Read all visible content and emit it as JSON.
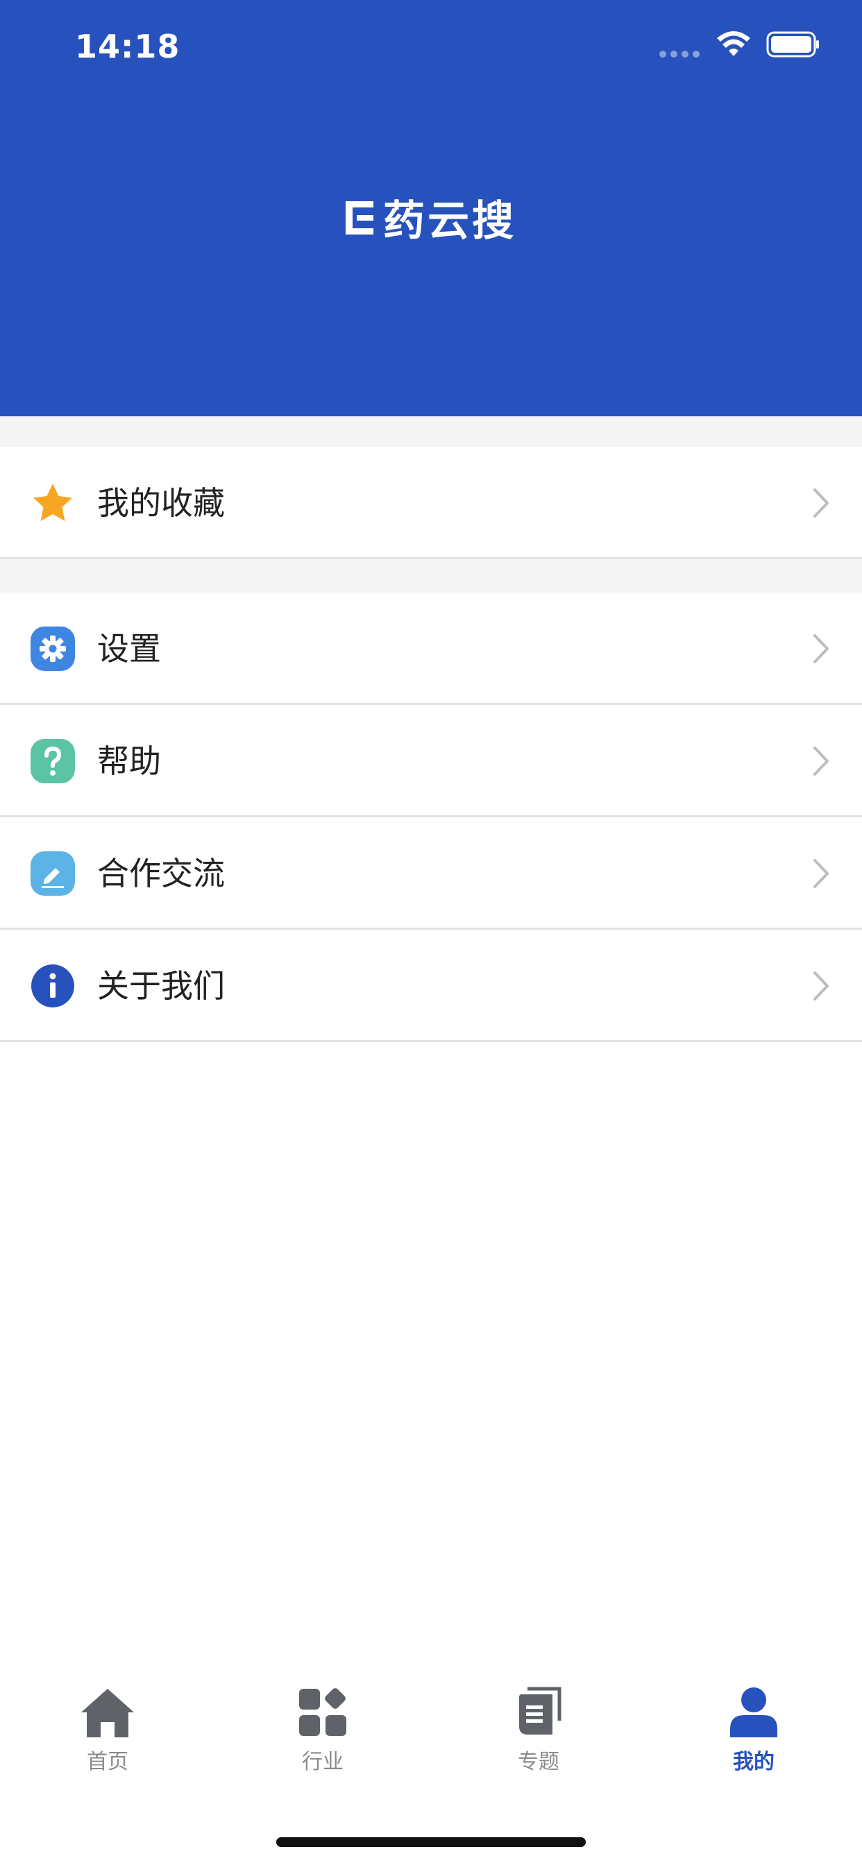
{
  "status_bar": {
    "time": "14:18"
  },
  "header": {
    "logo_text": "药云搜"
  },
  "menu": {
    "favorites": {
      "label": "我的收藏",
      "icon": "star-icon",
      "icon_color": "#F6A623"
    },
    "settings": {
      "label": "设置",
      "icon": "gear-icon",
      "icon_color": "#3F86E2"
    },
    "help": {
      "label": "帮助",
      "icon": "question-icon",
      "icon_color": "#5AC4A5"
    },
    "cooperation": {
      "label": "合作交流",
      "icon": "pencil-icon",
      "icon_color": "#5BB3E6"
    },
    "about": {
      "label": "关于我们",
      "icon": "info-icon",
      "icon_color": "#2752BD"
    }
  },
  "tabbar": {
    "items": [
      {
        "label": "首页",
        "icon": "home-icon",
        "active": false
      },
      {
        "label": "行业",
        "icon": "grid-icon",
        "active": false
      },
      {
        "label": "专题",
        "icon": "document-icon",
        "active": false
      },
      {
        "label": "我的",
        "icon": "user-icon",
        "active": true
      }
    ]
  },
  "colors": {
    "brand": "#2752BD",
    "inactive_tab": "#5F6368",
    "background_band": "#F4F4F4"
  }
}
